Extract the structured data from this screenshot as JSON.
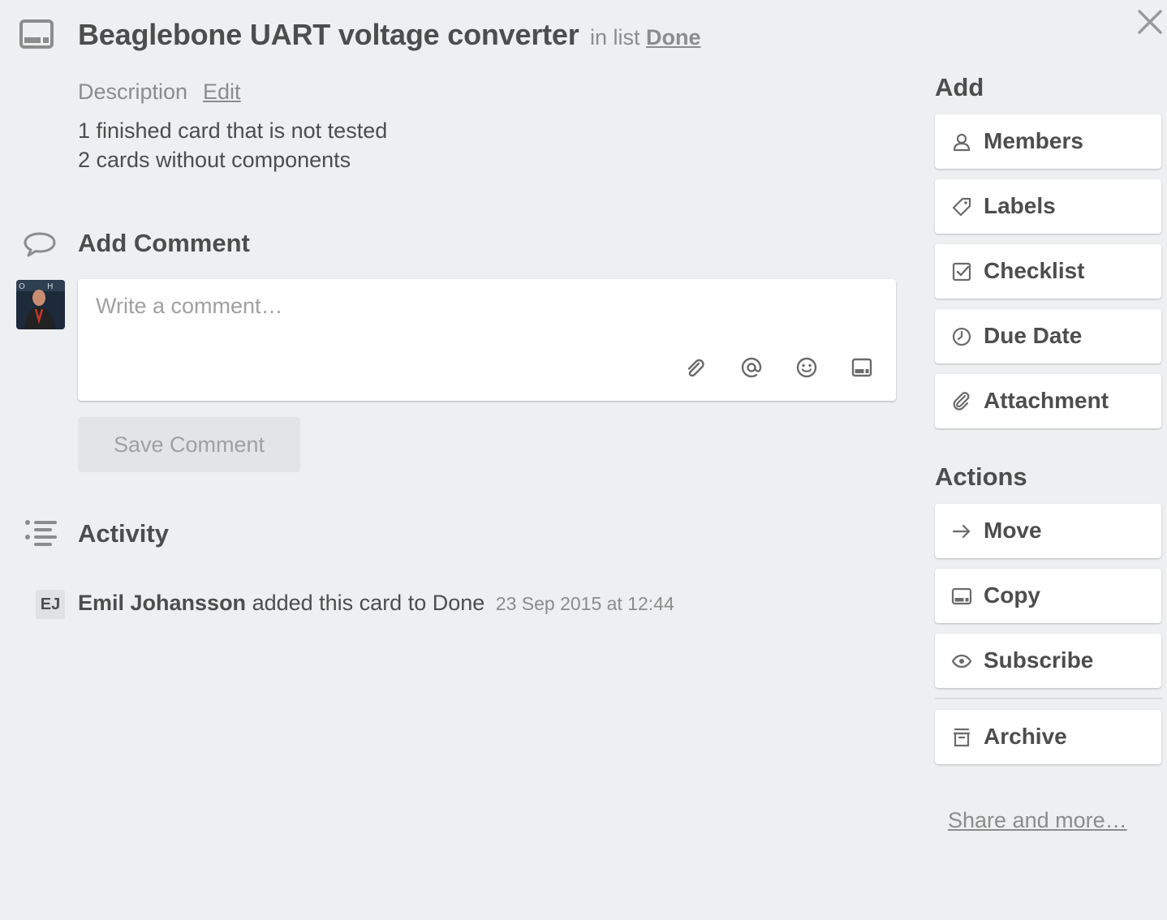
{
  "card": {
    "title": "Beaglebone UART voltage converter",
    "in_list_prefix": "in list",
    "list_name": "Done"
  },
  "description": {
    "label": "Description",
    "edit_label": "Edit",
    "lines": [
      "1 finished card that is not tested",
      "2 cards without components"
    ]
  },
  "comment": {
    "title": "Add Comment",
    "placeholder": "Write a comment…",
    "save_label": "Save Comment",
    "toolbar_icons": [
      "paperclip-icon",
      "at-icon",
      "emoji-icon",
      "card-icon"
    ]
  },
  "activity": {
    "title": "Activity",
    "items": [
      {
        "initials": "EJ",
        "member": "Emil Johansson",
        "action": "added this card to Done",
        "time": "23 Sep 2015 at 12:44"
      }
    ]
  },
  "sidebar": {
    "add_heading": "Add",
    "add_buttons": [
      {
        "label": "Members",
        "icon": "person-icon"
      },
      {
        "label": "Labels",
        "icon": "tag-icon"
      },
      {
        "label": "Checklist",
        "icon": "checkbox-icon"
      },
      {
        "label": "Due Date",
        "icon": "clock-icon"
      },
      {
        "label": "Attachment",
        "icon": "paperclip-icon"
      }
    ],
    "actions_heading": "Actions",
    "action_buttons": [
      {
        "label": "Move",
        "icon": "arrow-right-icon"
      },
      {
        "label": "Copy",
        "icon": "card-icon"
      },
      {
        "label": "Subscribe",
        "icon": "eye-icon"
      },
      {
        "label": "Archive",
        "icon": "archive-icon"
      }
    ],
    "share_label": "Share and more…"
  },
  "colors": {
    "background": "#edeff0",
    "text": "#4d4d4d",
    "muted": "#8c8c8c",
    "button_bg": "#ffffff",
    "disabled_bg": "#e2e4e6"
  }
}
